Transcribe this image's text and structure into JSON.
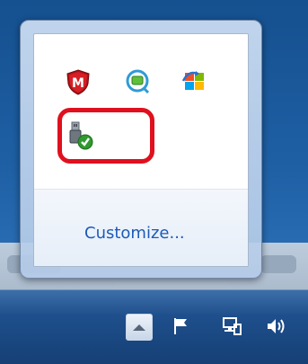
{
  "popup": {
    "customize_label": "Customize...",
    "icons": [
      {
        "name": "mcafee-shield-icon",
        "label": "M"
      },
      {
        "name": "sync-center-icon"
      },
      {
        "name": "windows-update-icon"
      },
      {
        "name": "safely-remove-hardware-icon"
      }
    ]
  },
  "highlight": {
    "color": "#e0101e"
  },
  "taskbar": {
    "tray_icons": [
      "show-hidden-icons-button",
      "action-center-flag-icon",
      "network-icon",
      "volume-icon"
    ]
  },
  "colors": {
    "link": "#1b5bb8",
    "taskbar": "#1e4f8c"
  }
}
